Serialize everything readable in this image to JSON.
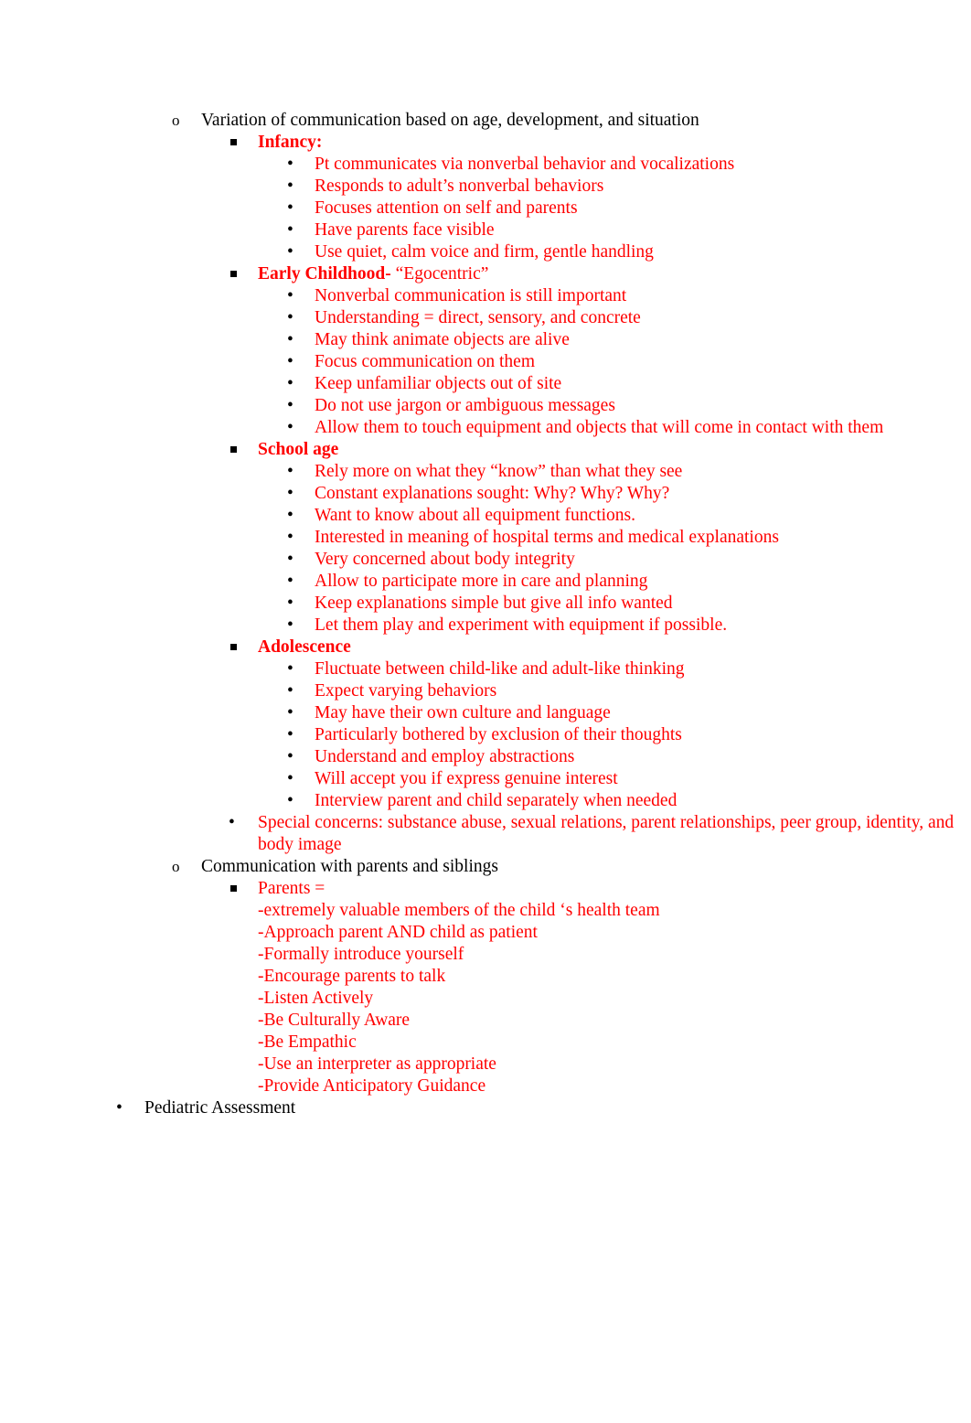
{
  "document": {
    "bullet_glyphs": {
      "round": "•",
      "circle_o": "o",
      "square": "▪"
    },
    "colors": {
      "body_text": "#000000",
      "highlight_text": "#FF0000",
      "page_background": "#FFFFFF"
    },
    "outline": {
      "variation_heading": "Variation of communication based on age, development, and situation",
      "infancy": {
        "heading": "Infancy:",
        "items": [
          "Pt communicates via nonverbal behavior and vocalizations",
          "Responds to adult’s nonverbal behaviors",
          "Focuses attention on self and parents",
          "Have parents face visible",
          "Use quiet, calm voice and firm, gentle handling"
        ]
      },
      "early_childhood": {
        "heading_bold": "Early Childhood-",
        "heading_rest": " “Egocentric”",
        "items": [
          "Nonverbal communication is still important",
          "Understanding = direct, sensory, and concrete",
          "May think animate objects are alive",
          "Focus communication on them",
          "Keep unfamiliar objects out of site",
          "Do not use jargon or ambiguous messages",
          "Allow them to touch equipment and objects that will come in contact with them"
        ]
      },
      "school_age": {
        "heading": "School age",
        "items": [
          "Rely more on what they “know” than what they see",
          "Constant explanations sought: Why? Why? Why?",
          "Want to know about all equipment functions.",
          "Interested in meaning of hospital terms and medical explanations",
          "Very concerned about body integrity",
          "Allow to participate more in care and planning",
          "Keep explanations simple but give all info wanted",
          "Let them play and experiment with equipment if possible."
        ]
      },
      "adolescence": {
        "heading": "Adolescence",
        "items": [
          "Fluctuate between child-like and adult-like thinking",
          "Expect varying behaviors",
          "May have their own culture and language",
          "Particularly bothered by exclusion of their thoughts",
          "Understand and employ abstractions",
          "Will accept you if express genuine interest",
          "Interview parent and child separately when needed"
        ]
      },
      "special_concerns": "Special concerns: substance abuse, sexual relations, parent relationships, peer group, identity, and body image",
      "communication_parents_siblings": "Communication with parents and siblings",
      "parents_block": "Parents =\n-extremely valuable members of the child ‘s health team\n-Approach parent AND child as patient\n-Formally introduce yourself\n-Encourage parents to talk\n-Listen Actively\n-Be Culturally Aware\n-Be Empathic\n-Use an interpreter as appropriate\n-Provide Anticipatory Guidance",
      "pediatric_assessment": "Pediatric Assessment"
    }
  }
}
